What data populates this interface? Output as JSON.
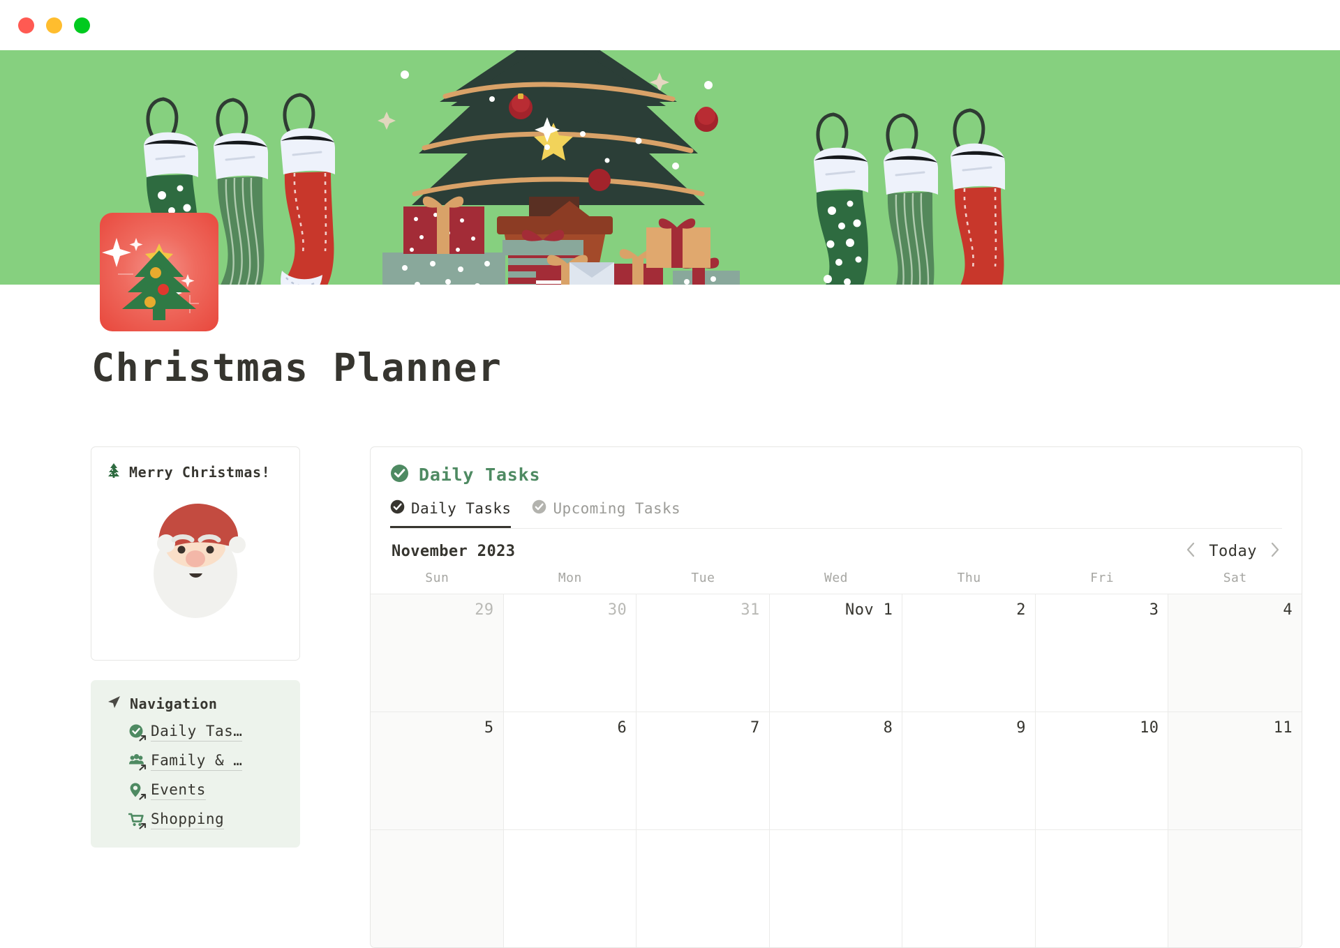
{
  "window": {
    "traffic_lights": [
      "close-button",
      "minimize-button",
      "maximize-button"
    ],
    "colors": {
      "close": "#ff5a52",
      "minimize": "#ffbd2e",
      "maximize": "#00ca1f"
    }
  },
  "banner": {
    "background_color": "#86d07f",
    "decorations": [
      "stockings-left",
      "christmas-tree-with-gifts",
      "stockings-right"
    ]
  },
  "page": {
    "icon_name": "christmas-tree-icon",
    "icon_bg_color": "#e8473c",
    "title": "Christmas Planner"
  },
  "sidebar": {
    "merry_card": {
      "icon": "evergreen-tree-icon",
      "title": "Merry Christmas!",
      "illustration": "santa-face-illustration"
    },
    "navigation": {
      "icon": "navigation-arrow-icon",
      "title": "Navigation",
      "items": [
        {
          "label": "Daily Tas…",
          "icon": "check-circle-icon"
        },
        {
          "label": "Family & …",
          "icon": "people-group-icon"
        },
        {
          "label": "Events",
          "icon": "map-pin-icon"
        },
        {
          "label": "Shopping",
          "icon": "shopping-cart-icon"
        }
      ]
    }
  },
  "main": {
    "panel_icon": "check-circle-icon",
    "panel_title": "Daily Tasks",
    "panel_title_color": "#4e8a62",
    "tabs": [
      {
        "label": "Daily Tasks",
        "icon": "check-circle-icon",
        "active": true
      },
      {
        "label": "Upcoming Tasks",
        "icon": "check-circle-icon",
        "active": false
      }
    ],
    "calendar": {
      "month_label": "November 2023",
      "today_label": "Today",
      "prev_icon": "chevron-left-icon",
      "next_icon": "chevron-right-icon",
      "weekdays": [
        "Sun",
        "Mon",
        "Tue",
        "Wed",
        "Thu",
        "Fri",
        "Sat"
      ],
      "weeks": [
        [
          {
            "label": "29",
            "muted": true,
            "weekend": true
          },
          {
            "label": "30",
            "muted": true,
            "weekend": false
          },
          {
            "label": "31",
            "muted": true,
            "weekend": false
          },
          {
            "label": "Nov 1",
            "muted": false,
            "weekend": false
          },
          {
            "label": "2",
            "muted": false,
            "weekend": false
          },
          {
            "label": "3",
            "muted": false,
            "weekend": false
          },
          {
            "label": "4",
            "muted": false,
            "weekend": true
          }
        ],
        [
          {
            "label": "5",
            "muted": false,
            "weekend": true
          },
          {
            "label": "6",
            "muted": false,
            "weekend": false
          },
          {
            "label": "7",
            "muted": false,
            "weekend": false
          },
          {
            "label": "8",
            "muted": false,
            "weekend": false
          },
          {
            "label": "9",
            "muted": false,
            "weekend": false
          },
          {
            "label": "10",
            "muted": false,
            "weekend": false
          },
          {
            "label": "11",
            "muted": false,
            "weekend": true
          }
        ],
        [
          {
            "label": "",
            "muted": false,
            "weekend": true
          },
          {
            "label": "",
            "muted": false,
            "weekend": false
          },
          {
            "label": "",
            "muted": false,
            "weekend": false
          },
          {
            "label": "",
            "muted": false,
            "weekend": false
          },
          {
            "label": "",
            "muted": false,
            "weekend": false
          },
          {
            "label": "",
            "muted": false,
            "weekend": false
          },
          {
            "label": "",
            "muted": false,
            "weekend": true
          }
        ]
      ]
    }
  }
}
